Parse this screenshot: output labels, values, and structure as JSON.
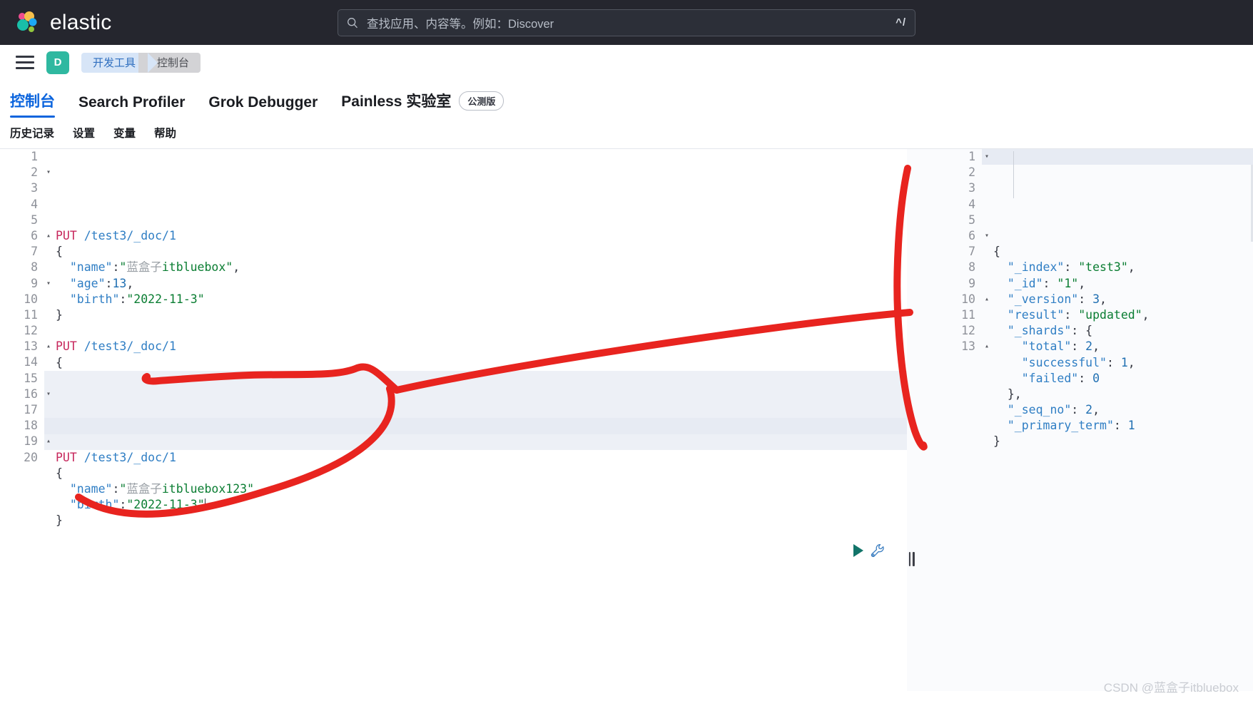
{
  "topbar": {
    "brand": "elastic",
    "logo_icon": "elastic-logo",
    "search": {
      "icon": "search-icon",
      "placeholder": "查找应用、内容等。例如：Discover",
      "value": "",
      "shortcut": "^/"
    }
  },
  "navrow": {
    "menu_icon": "hamburger-menu-icon",
    "space_avatar": "D",
    "breadcrumbs": [
      {
        "label": "开发工具",
        "current": false
      },
      {
        "label": "控制台",
        "current": true
      }
    ]
  },
  "tabs": [
    {
      "label": "控制台",
      "active": true,
      "badge": ""
    },
    {
      "label": "Search Profiler",
      "active": false,
      "badge": ""
    },
    {
      "label": "Grok Debugger",
      "active": false,
      "badge": ""
    },
    {
      "label": "Painless 实验室",
      "active": false,
      "badge": "公测版"
    }
  ],
  "subbar": [
    {
      "label": "历史记录"
    },
    {
      "label": "设置"
    },
    {
      "label": "变量"
    },
    {
      "label": "帮助"
    }
  ],
  "editor": {
    "lines": [
      {
        "n": "1",
        "fold": "",
        "tokens": [
          {
            "t": "PUT",
            "c": "k-method"
          },
          {
            "t": " ",
            "c": "k-punc"
          },
          {
            "t": "/test3/_doc/1",
            "c": "k-url"
          }
        ]
      },
      {
        "n": "2",
        "fold": "▾",
        "tokens": [
          {
            "t": "{",
            "c": "k-punc"
          }
        ]
      },
      {
        "n": "3",
        "fold": "",
        "tokens": [
          {
            "t": "  ",
            "c": "k-punc"
          },
          {
            "t": "\"name\"",
            "c": "k-key"
          },
          {
            "t": ":",
            "c": "k-punc"
          },
          {
            "t": "\"",
            "c": "k-str"
          },
          {
            "t": "蓝盒子",
            "c": "k-cn"
          },
          {
            "t": "itbluebox\"",
            "c": "k-str"
          },
          {
            "t": ",",
            "c": "k-punc"
          }
        ]
      },
      {
        "n": "4",
        "fold": "",
        "tokens": [
          {
            "t": "  ",
            "c": "k-punc"
          },
          {
            "t": "\"age\"",
            "c": "k-key"
          },
          {
            "t": ":",
            "c": "k-punc"
          },
          {
            "t": "13",
            "c": "k-num"
          },
          {
            "t": ",",
            "c": "k-punc"
          }
        ]
      },
      {
        "n": "5",
        "fold": "",
        "tokens": [
          {
            "t": "  ",
            "c": "k-punc"
          },
          {
            "t": "\"birth\"",
            "c": "k-key"
          },
          {
            "t": ":",
            "c": "k-punc"
          },
          {
            "t": "\"2022-11-3\"",
            "c": "k-str"
          }
        ]
      },
      {
        "n": "6",
        "fold": "▴",
        "tokens": [
          {
            "t": "}",
            "c": "k-punc"
          }
        ]
      },
      {
        "n": "7",
        "fold": "",
        "tokens": []
      },
      {
        "n": "8",
        "fold": "",
        "tokens": [
          {
            "t": "PUT",
            "c": "k-method"
          },
          {
            "t": " ",
            "c": "k-punc"
          },
          {
            "t": "/test3/_doc/1",
            "c": "k-url"
          }
        ]
      },
      {
        "n": "9",
        "fold": "▾",
        "tokens": [
          {
            "t": "{",
            "c": "k-punc"
          }
        ]
      },
      {
        "n": "10",
        "fold": "",
        "tokens": [
          {
            "t": "  ",
            "c": "k-punc"
          },
          {
            "t": "\"name\"",
            "c": "k-key"
          },
          {
            "t": ":",
            "c": "k-punc"
          },
          {
            "t": "\"",
            "c": "k-str"
          },
          {
            "t": "蓝盒子",
            "c": "k-cn"
          },
          {
            "t": "itbluebox123\"",
            "c": "k-str"
          },
          {
            "t": ",",
            "c": "k-punc"
          }
        ]
      },
      {
        "n": "11",
        "fold": "",
        "tokens": [
          {
            "t": "  ",
            "c": "k-punc"
          },
          {
            "t": "\"age\"",
            "c": "k-key"
          },
          {
            "t": ":",
            "c": "k-punc"
          },
          {
            "t": "13",
            "c": "k-num"
          },
          {
            "t": ",",
            "c": "k-punc"
          }
        ]
      },
      {
        "n": "12",
        "fold": "",
        "tokens": [
          {
            "t": "  ",
            "c": "k-punc"
          },
          {
            "t": "\"birth\"",
            "c": "k-key"
          },
          {
            "t": ":",
            "c": "k-punc"
          },
          {
            "t": "\"2022-11-3\"",
            "c": "k-str"
          }
        ]
      },
      {
        "n": "13",
        "fold": "▴",
        "tokens": [
          {
            "t": "}",
            "c": "k-punc"
          }
        ]
      },
      {
        "n": "14",
        "fold": "",
        "tokens": []
      },
      {
        "n": "15",
        "fold": "",
        "tokens": [
          {
            "t": "PUT",
            "c": "k-method"
          },
          {
            "t": " ",
            "c": "k-punc"
          },
          {
            "t": "/test3/_doc/1",
            "c": "k-url"
          }
        ]
      },
      {
        "n": "16",
        "fold": "▾",
        "tokens": [
          {
            "t": "{",
            "c": "k-punc"
          }
        ]
      },
      {
        "n": "17",
        "fold": "",
        "tokens": [
          {
            "t": "  ",
            "c": "k-punc"
          },
          {
            "t": "\"name\"",
            "c": "k-key"
          },
          {
            "t": ":",
            "c": "k-punc"
          },
          {
            "t": "\"",
            "c": "k-str"
          },
          {
            "t": "蓝盒子",
            "c": "k-cn"
          },
          {
            "t": "itbluebox123\"",
            "c": "k-str"
          },
          {
            "t": ",",
            "c": "k-punc"
          }
        ]
      },
      {
        "n": "18",
        "fold": "",
        "tokens": [
          {
            "t": "  ",
            "c": "k-punc"
          },
          {
            "t": "\"birth\"",
            "c": "k-key"
          },
          {
            "t": ":",
            "c": "k-punc"
          },
          {
            "t": "\"2022-11-3\"",
            "c": "k-str"
          }
        ],
        "caret": true
      },
      {
        "n": "19",
        "fold": "▴",
        "tokens": [
          {
            "t": "}",
            "c": "k-punc"
          }
        ]
      },
      {
        "n": "20",
        "fold": "",
        "tokens": []
      }
    ],
    "active_line": "18",
    "actions": {
      "play_icon": "play-request-icon",
      "wrench_icon": "wrench-icon"
    }
  },
  "response": {
    "lines": [
      {
        "n": "1",
        "fold": "▾",
        "tokens": [
          {
            "t": "{",
            "c": "k-punc"
          }
        ]
      },
      {
        "n": "2",
        "fold": "",
        "tokens": [
          {
            "t": "  ",
            "c": "k-punc"
          },
          {
            "t": "\"_index\"",
            "c": "k-key"
          },
          {
            "t": ": ",
            "c": "k-punc"
          },
          {
            "t": "\"test3\"",
            "c": "k-str"
          },
          {
            "t": ",",
            "c": "k-punc"
          }
        ]
      },
      {
        "n": "3",
        "fold": "",
        "tokens": [
          {
            "t": "  ",
            "c": "k-punc"
          },
          {
            "t": "\"_id\"",
            "c": "k-key"
          },
          {
            "t": ": ",
            "c": "k-punc"
          },
          {
            "t": "\"1\"",
            "c": "k-str"
          },
          {
            "t": ",",
            "c": "k-punc"
          }
        ]
      },
      {
        "n": "4",
        "fold": "",
        "tokens": [
          {
            "t": "  ",
            "c": "k-punc"
          },
          {
            "t": "\"_version\"",
            "c": "k-key"
          },
          {
            "t": ": ",
            "c": "k-punc"
          },
          {
            "t": "3",
            "c": "k-num"
          },
          {
            "t": ",",
            "c": "k-punc"
          }
        ]
      },
      {
        "n": "5",
        "fold": "",
        "tokens": [
          {
            "t": "  ",
            "c": "k-punc"
          },
          {
            "t": "\"result\"",
            "c": "k-key"
          },
          {
            "t": ": ",
            "c": "k-punc"
          },
          {
            "t": "\"updated\"",
            "c": "k-str"
          },
          {
            "t": ",",
            "c": "k-punc"
          }
        ]
      },
      {
        "n": "6",
        "fold": "▾",
        "tokens": [
          {
            "t": "  ",
            "c": "k-punc"
          },
          {
            "t": "\"_shards\"",
            "c": "k-key"
          },
          {
            "t": ": ",
            "c": "k-punc"
          },
          {
            "t": "{",
            "c": "k-punc"
          }
        ]
      },
      {
        "n": "7",
        "fold": "",
        "tokens": [
          {
            "t": "    ",
            "c": "k-punc"
          },
          {
            "t": "\"total\"",
            "c": "k-key"
          },
          {
            "t": ": ",
            "c": "k-punc"
          },
          {
            "t": "2",
            "c": "k-num"
          },
          {
            "t": ",",
            "c": "k-punc"
          }
        ]
      },
      {
        "n": "8",
        "fold": "",
        "tokens": [
          {
            "t": "    ",
            "c": "k-punc"
          },
          {
            "t": "\"successful\"",
            "c": "k-key"
          },
          {
            "t": ": ",
            "c": "k-punc"
          },
          {
            "t": "1",
            "c": "k-num"
          },
          {
            "t": ",",
            "c": "k-punc"
          }
        ]
      },
      {
        "n": "9",
        "fold": "",
        "tokens": [
          {
            "t": "    ",
            "c": "k-punc"
          },
          {
            "t": "\"failed\"",
            "c": "k-key"
          },
          {
            "t": ": ",
            "c": "k-punc"
          },
          {
            "t": "0",
            "c": "k-num"
          }
        ]
      },
      {
        "n": "10",
        "fold": "▴",
        "tokens": [
          {
            "t": "  ",
            "c": "k-punc"
          },
          {
            "t": "},",
            "c": "k-punc"
          }
        ]
      },
      {
        "n": "11",
        "fold": "",
        "tokens": [
          {
            "t": "  ",
            "c": "k-punc"
          },
          {
            "t": "\"_seq_no\"",
            "c": "k-key"
          },
          {
            "t": ": ",
            "c": "k-punc"
          },
          {
            "t": "2",
            "c": "k-num"
          },
          {
            "t": ",",
            "c": "k-punc"
          }
        ]
      },
      {
        "n": "12",
        "fold": "",
        "tokens": [
          {
            "t": "  ",
            "c": "k-punc"
          },
          {
            "t": "\"_primary_term\"",
            "c": "k-key"
          },
          {
            "t": ": ",
            "c": "k-punc"
          },
          {
            "t": "1",
            "c": "k-num"
          }
        ]
      },
      {
        "n": "13",
        "fold": "▴",
        "tokens": [
          {
            "t": "}",
            "c": "k-punc"
          }
        ]
      }
    ],
    "active_line": "1"
  },
  "splitter": {
    "icon": "pane-resize-grip"
  },
  "annotation": {
    "name": "red-handdrawn-annotation",
    "color": "#e8241f",
    "stroke": 9
  },
  "watermark": "CSDN @蓝盒子itbluebox"
}
